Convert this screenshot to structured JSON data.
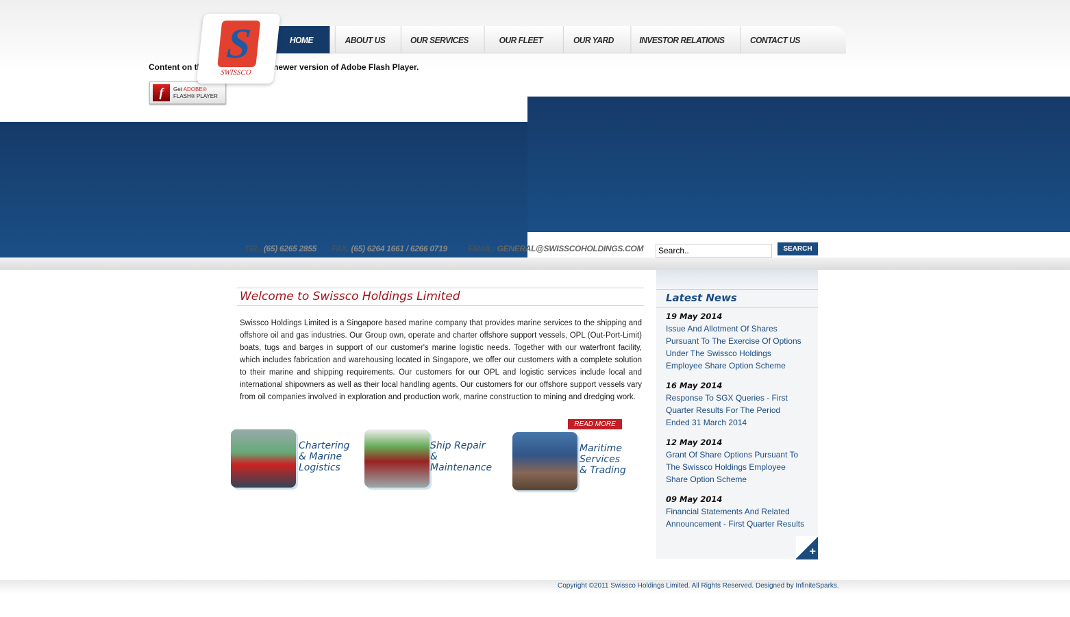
{
  "nav": {
    "items": [
      "HOME",
      "ABOUT US",
      "OUR SERVICES",
      "OUR FLEET",
      "OUR YARD",
      "INVESTOR RELATIONS",
      "CONTACT US"
    ],
    "active": "HOME"
  },
  "logo": {
    "text": "SWISSCO"
  },
  "flash": {
    "message_left": "Content on th",
    "message_right": "newer version of Adobe Flash Player.",
    "button_get": "Get",
    "button_adobe": "ADOBE®",
    "button_player": "FLASH® PLAYER"
  },
  "contact": {
    "tel_label": "TEL",
    "tel": "(65) 6265 2855",
    "fax_label": "FAX",
    "fax": "(65) 6264 1661 / 6266 0719",
    "email_label": "EMAIL",
    "email": "GENERAL@SWISSCOHOLDINGS.COM"
  },
  "search": {
    "value": "Search..",
    "button": "SEARCH"
  },
  "main": {
    "title": "Welcome to Swissco Holdings Limited",
    "intro": "Swissco Holdings Limited is a Singapore based marine company that provides marine services to the shipping and offshore oil and gas industries. Our Group own, operate and charter offshore support vessels, OPL (Out-Port-Limit) boats, tugs and barges in support of our customer's marine logistic needs. Together with our waterfront facility, which includes fabrication and warehousing located in Singapore, we offer our customers with a complete solution to their marine and shipping requirements. Our customers for our OPL and logistic services include local and international shipowners as well as their local handling agents. Our customers for our offshore support vessels vary from oil companies involved in exploration and production work, marine construction to mining and dredging work.",
    "read_more": "READ MORE",
    "services": [
      {
        "l1": "Chartering",
        "l2": "& Marine",
        "l3": "Logistics"
      },
      {
        "l1": "Ship Repair",
        "l2": "&",
        "l3": "Maintenance"
      },
      {
        "l1": "Maritime",
        "l2": "Services",
        "l3": "& Trading"
      }
    ]
  },
  "news": {
    "title": "Latest News",
    "items": [
      {
        "date": "19 May 2014",
        "lines": [
          "Issue And Allotment Of Shares",
          "Pursuant To The Exercise Of Options",
          "Under The Swissco Holdings",
          "Employee Share Option Scheme"
        ]
      },
      {
        "date": "16 May 2014",
        "lines": [
          "Response To SGX Queries - First",
          "Quarter Results For The Period",
          "Ended 31 March 2014"
        ]
      },
      {
        "date": "12 May 2014",
        "lines": [
          "Grant Of Share Options Pursuant To",
          "The Swissco Holdings Employee",
          "Share Option Scheme"
        ]
      },
      {
        "date": "09 May 2014",
        "lines": [
          "Financial Statements And Related",
          "Announcement - First Quarter Results"
        ]
      }
    ],
    "more_icon": "plus-icon"
  },
  "footer": {
    "copyright": "Copyright ©2011 Swissco Holdings Limited. All Rights Reserved. Designed by InfiniteSparks."
  },
  "colors": {
    "navy": "#153a68",
    "accent_red": "#c41e24",
    "link_blue": "#1b4c80"
  }
}
